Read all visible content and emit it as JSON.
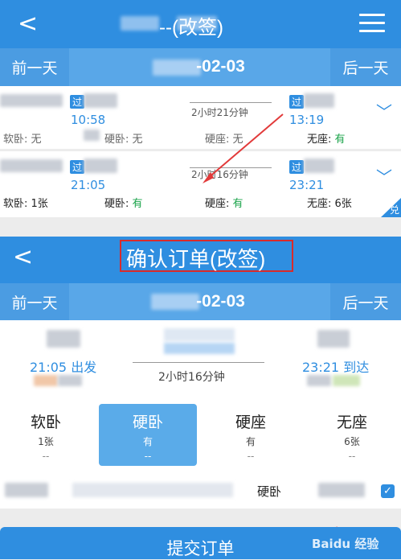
{
  "top": {
    "back": "<",
    "title": "--(改签)",
    "prev_day": "前一天",
    "next_day": "后一天",
    "date": "-02-03",
    "trains": [
      {
        "badge": "过",
        "depart": "10:58",
        "duration": "2小时21分钟",
        "badge2": "过",
        "arrive": "13:19",
        "seats": [
          {
            "label": "软卧: ",
            "val": "无"
          },
          {
            "label": "硬卧: ",
            "val": "无"
          },
          {
            "label": "硬座: ",
            "val": "无"
          },
          {
            "label": "无座: ",
            "val": "有"
          }
        ]
      },
      {
        "badge": "过",
        "depart": "21:05",
        "duration": "2小时16分钟",
        "badge2": "过",
        "arrive": "23:21",
        "seats": [
          {
            "label": "软卧: ",
            "val": "1张"
          },
          {
            "label": "硬卧: ",
            "val": "有"
          },
          {
            "label": "硬座: ",
            "val": "有"
          },
          {
            "label": "无座: ",
            "val": "6张"
          }
        ]
      }
    ],
    "corner_tag": "兑"
  },
  "bottom": {
    "back": "<",
    "title": "确认订单(改签)",
    "prev_day": "前一天",
    "next_day": "后一天",
    "date": "-02-03",
    "depart": "21:05 出发",
    "arrive": "23:21 到达",
    "duration": "2小时16分钟",
    "seats": [
      {
        "name": "软卧",
        "count": "1张",
        "price": "--"
      },
      {
        "name": "硬卧",
        "count": "有",
        "price": "--"
      },
      {
        "name": "硬座",
        "count": "有",
        "price": "--"
      },
      {
        "name": "无座",
        "count": "6张",
        "price": "--"
      }
    ],
    "passenger_seat": "硬卧",
    "check": "✓",
    "submit": "提交订单"
  },
  "watermark": "Baidu 经验",
  "colors": {
    "primary": "#2f8ee0",
    "available": "#1aa34a",
    "highlight": "#d92b2b"
  }
}
